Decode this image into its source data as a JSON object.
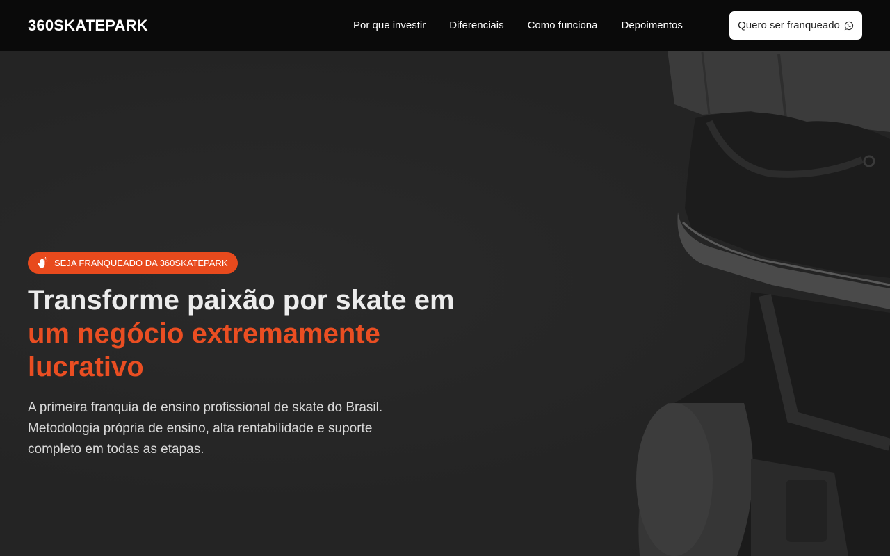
{
  "header": {
    "brand": "360SKATEPARK",
    "nav": [
      {
        "label": "Por que investir"
      },
      {
        "label": "Diferenciais"
      },
      {
        "label": "Como funciona"
      },
      {
        "label": "Depoimentos"
      }
    ],
    "cta_label": "Quero ser franqueado",
    "cta_icon": "whatsapp-icon"
  },
  "hero": {
    "badge_label": "SEJA FRANQUEADO DA 360SKATEPARK",
    "badge_icon": "hand-icon",
    "headline_part1": "Transforme paixão por skate em ",
    "headline_accent": "um negócio extremamente lucrativo",
    "subtitle": "A primeira franquia de ensino profissional de skate do Brasil. Metodologia própria de ensino, alta rentabilidade e suporte completo em todas as etapas."
  },
  "colors": {
    "accent": "#e84a1d",
    "navbar_bg": "#0a0a0a",
    "hero_bg": "#262626"
  }
}
